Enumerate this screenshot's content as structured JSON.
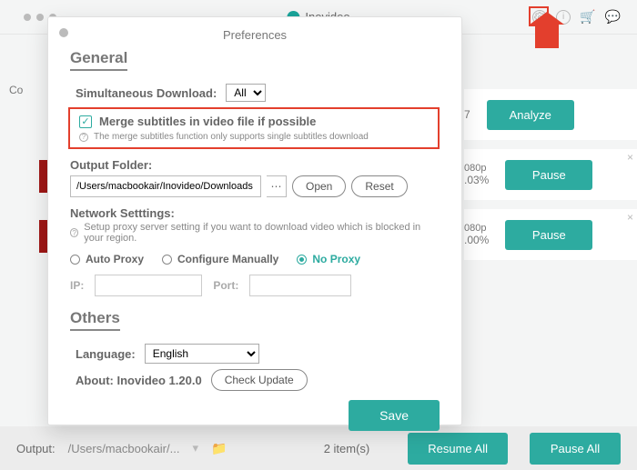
{
  "app": {
    "name": "Inovideo"
  },
  "top_icons": {
    "gear": "gear-icon",
    "info": "i",
    "cart": "cart-icon",
    "chat": "chat-icon"
  },
  "bg": {
    "input_label": "Co",
    "item1_row": "7",
    "analyze_btn": "Analyze",
    "item2_quality": "080p",
    "item2_pct": ".03%",
    "item2_btn": "Pause",
    "item3_quality": "080p",
    "item3_pct": ".00%",
    "item3_btn": "Pause"
  },
  "prefs": {
    "title": "Preferences",
    "general_h": "General",
    "simul_label": "Simultaneous Download:",
    "simul_value": "All",
    "merge_title": "Merge subtitles in video file if possible",
    "merge_hint": "The merge subtitles function only supports single subtitles download",
    "output_label": "Output Folder:",
    "output_path": "/Users/macbookair/Inovideo/Downloads",
    "open_btn": "Open",
    "reset_btn": "Reset",
    "net_h": "Network Setttings:",
    "net_hint": "Setup proxy server setting if you want to download video which is blocked in your region.",
    "auto": "Auto Proxy",
    "manual": "Configure Manually",
    "noproxy": "No Proxy",
    "ip_label": "IP:",
    "port_label": "Port:",
    "others_h": "Others",
    "lang_label": "Language:",
    "lang_value": "English",
    "about": "About: Inovideo 1.20.0",
    "check_update": "Check Update",
    "save": "Save"
  },
  "bottom": {
    "output_label": "Output:",
    "path_short": "/Users/macbookair/...",
    "count": "2 item(s)",
    "resume": "Resume All",
    "pause": "Pause All"
  }
}
